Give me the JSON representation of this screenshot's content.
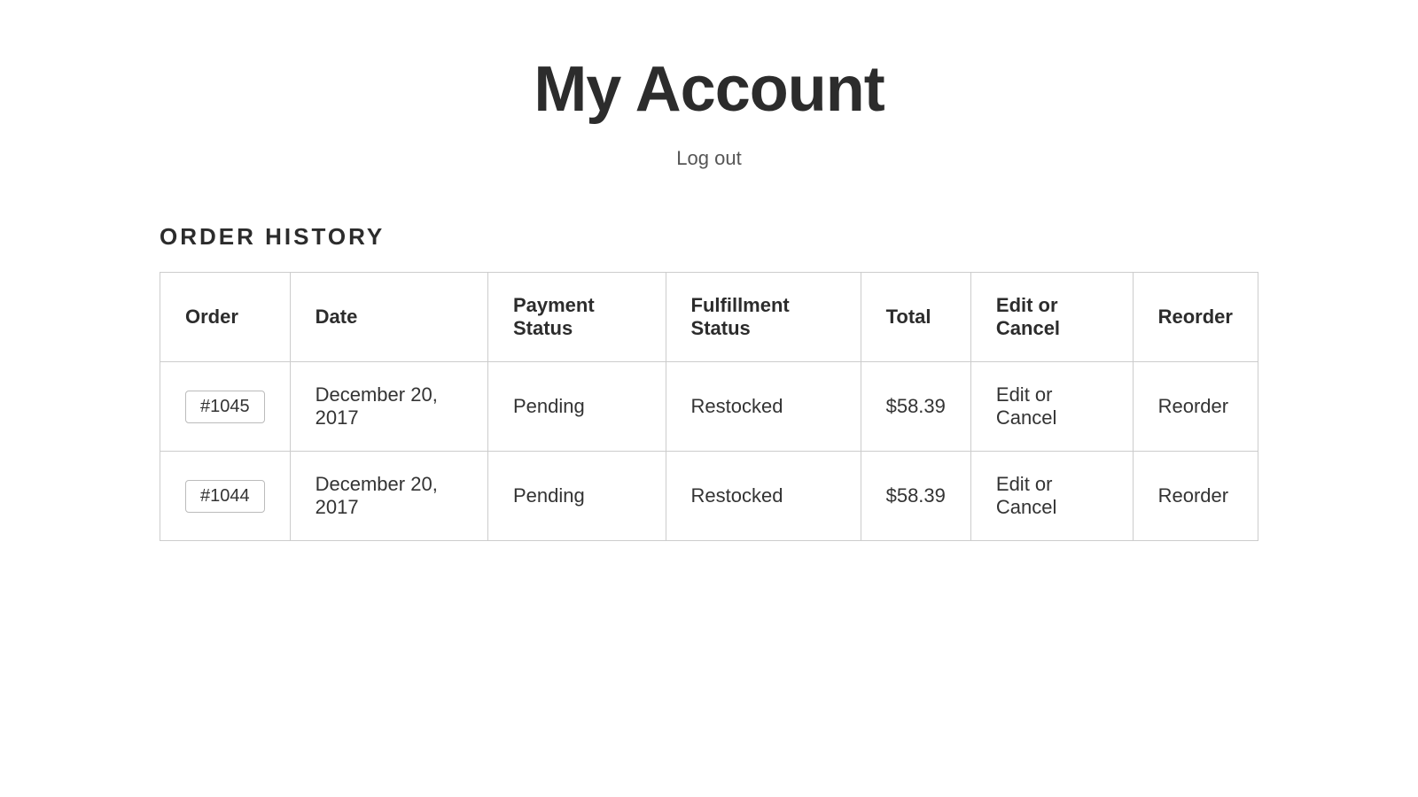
{
  "page": {
    "title": "My Account",
    "logout_label": "Log out"
  },
  "order_history": {
    "section_title": "ORDER HISTORY",
    "columns": [
      {
        "key": "order",
        "label": "Order"
      },
      {
        "key": "date",
        "label": "Date"
      },
      {
        "key": "payment_status",
        "label": "Payment Status"
      },
      {
        "key": "fulfillment_status",
        "label": "Fulfillment Status"
      },
      {
        "key": "total",
        "label": "Total"
      },
      {
        "key": "edit_cancel",
        "label": "Edit or Cancel"
      },
      {
        "key": "reorder",
        "label": "Reorder"
      }
    ],
    "rows": [
      {
        "order_number": "#1045",
        "date": "December 20, 2017",
        "payment_status": "Pending",
        "fulfillment_status": "Restocked",
        "total": "$58.39",
        "edit_cancel_label": "Edit or Cancel",
        "reorder_label": "Reorder"
      },
      {
        "order_number": "#1044",
        "date": "December 20, 2017",
        "payment_status": "Pending",
        "fulfillment_status": "Restocked",
        "total": "$58.39",
        "edit_cancel_label": "Edit or Cancel",
        "reorder_label": "Reorder"
      }
    ]
  }
}
